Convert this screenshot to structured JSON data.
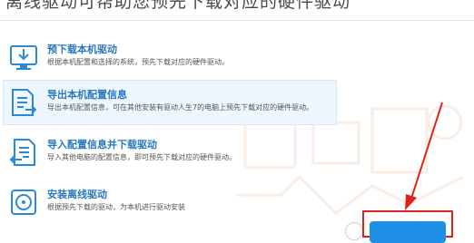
{
  "header": {
    "title": "离线驱动可帮助您预先下载对应的硬件驱动"
  },
  "options": [
    {
      "title": "预下载本机驱动",
      "desc": "根据本机配置和选择的系统，预先下载对应的硬件驱动。",
      "icon": "monitor-download-icon"
    },
    {
      "title": "导出本机配置信息",
      "desc": "导出本机配置信息，可在其他安装有驱动人生7的电脑上预先下载对应的硬件驱动。",
      "icon": "document-export-icon"
    },
    {
      "title": "导入配置信息并下载驱动",
      "desc": "导入其他电脑的配置信息，即可预先下载对应的硬件驱动。",
      "icon": "document-import-icon"
    },
    {
      "title": "安装离线驱动",
      "desc": "根据预先下载的驱动，为本机进行驱动安装",
      "icon": "disc-install-icon"
    }
  ],
  "colors": {
    "accent": "#2b78c2",
    "button": "#1f8fe5",
    "highlight": "#e0201a"
  }
}
